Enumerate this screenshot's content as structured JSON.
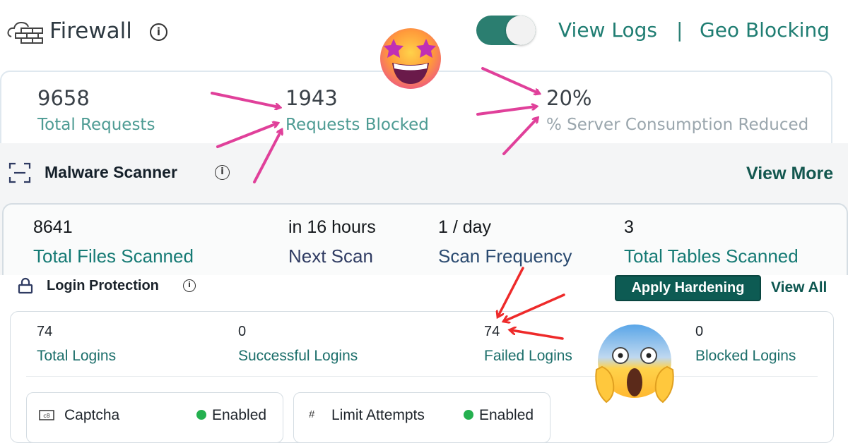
{
  "firewall": {
    "title": "Firewall",
    "toggle_on": true,
    "links": {
      "view_logs": "View Logs",
      "separator": "|",
      "geo_blocking": "Geo Blocking"
    },
    "stats": [
      {
        "value": "9658",
        "label": "Total Requests"
      },
      {
        "value": "1943",
        "label": "Requests Blocked"
      },
      {
        "value": "20%",
        "label": "% Server Consumption Reduced"
      }
    ]
  },
  "malware": {
    "title": "Malware Scanner",
    "view_more": "View More",
    "stats": [
      {
        "value": "8641",
        "label": "Total Files Scanned"
      },
      {
        "value": "in 16 hours",
        "label": "Next Scan"
      },
      {
        "value": "1 / day",
        "label": "Scan Frequency"
      },
      {
        "value": "3",
        "label": "Total Tables Scanned"
      }
    ]
  },
  "login": {
    "title": "Login Protection",
    "apply_hardening": "Apply Hardening",
    "view_all": "View All",
    "stats": [
      {
        "value": "74",
        "label": "Total Logins"
      },
      {
        "value": "0",
        "label": "Successful Logins"
      },
      {
        "value": "74",
        "label": "Failed Logins"
      },
      {
        "value": "0",
        "label": "Blocked Logins"
      }
    ],
    "features": [
      {
        "icon": "captcha-icon",
        "label": "Captcha",
        "status": "Enabled"
      },
      {
        "icon": "hash-icon",
        "glyph": "#",
        "label": "Limit Attempts",
        "status": "Enabled"
      }
    ]
  },
  "colors": {
    "accent": "#1f7d72",
    "button": "#0d5b53",
    "enabled_dot": "#24b04f",
    "arrow_pink": "#e0409a",
    "arrow_red": "#ee2a2a"
  },
  "decorations": [
    "star-struck-emoji",
    "screaming-in-fear-emoji",
    "pink-arrows",
    "red-arrows"
  ]
}
